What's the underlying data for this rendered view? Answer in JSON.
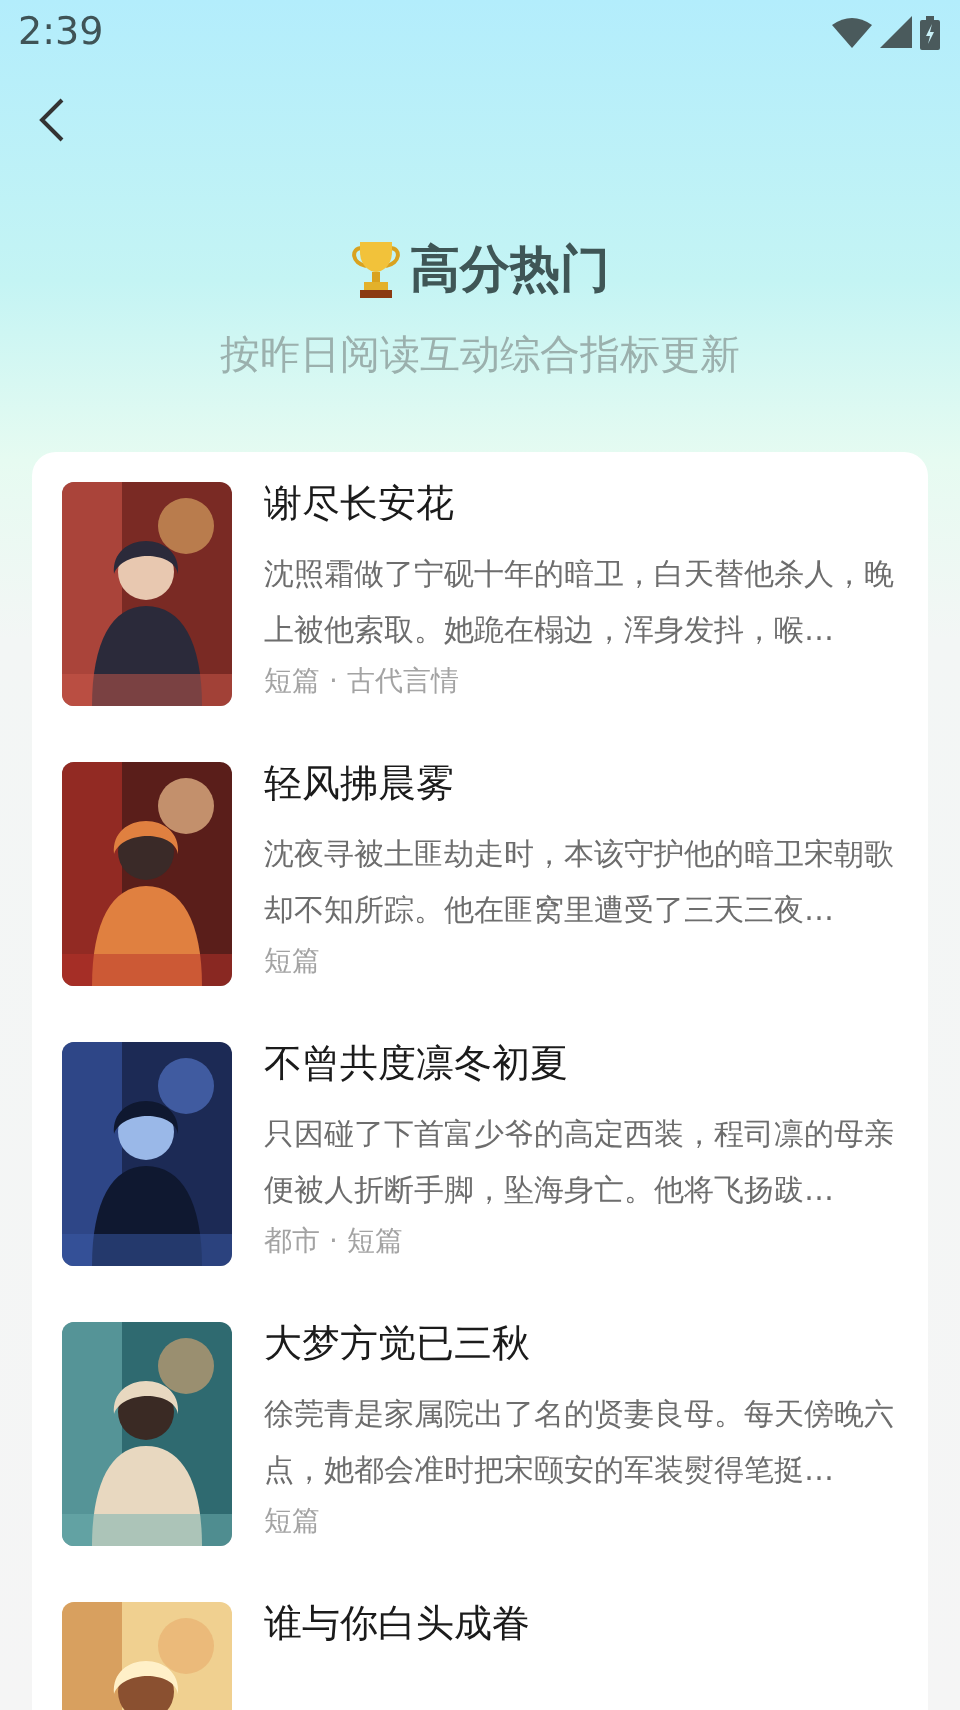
{
  "status_bar": {
    "time": "2:39"
  },
  "header": {
    "title": "高分热门",
    "subtitle": "按昨日阅读互动综合指标更新"
  },
  "books": [
    {
      "title": "谢尽长安花",
      "description": "沈照霜做了宁砚十年的暗卫，白天替他杀人，晚上被他索取。她跪在榻边，浑身发抖，喉…",
      "tags": "短篇 · 古代言情"
    },
    {
      "title": "轻风拂晨雾",
      "description": "沈夜寻被土匪劫走时，本该守护他的暗卫宋朝歌却不知所踪。他在匪窝里遭受了三天三夜…",
      "tags": "短篇"
    },
    {
      "title": "不曾共度凛冬初夏",
      "description": "只因碰了下首富少爷的高定西装，程司凛的母亲便被人折断手脚，坠海身亡。他将飞扬跋…",
      "tags": "都市 · 短篇"
    },
    {
      "title": "大梦方觉已三秋",
      "description": "徐莞青是家属院出了名的贤妻良母。每天傍晚六点，她都会准时把宋颐安的军装熨得笔挺…",
      "tags": "短篇"
    },
    {
      "title": "谁与你白头成眷"
    }
  ]
}
